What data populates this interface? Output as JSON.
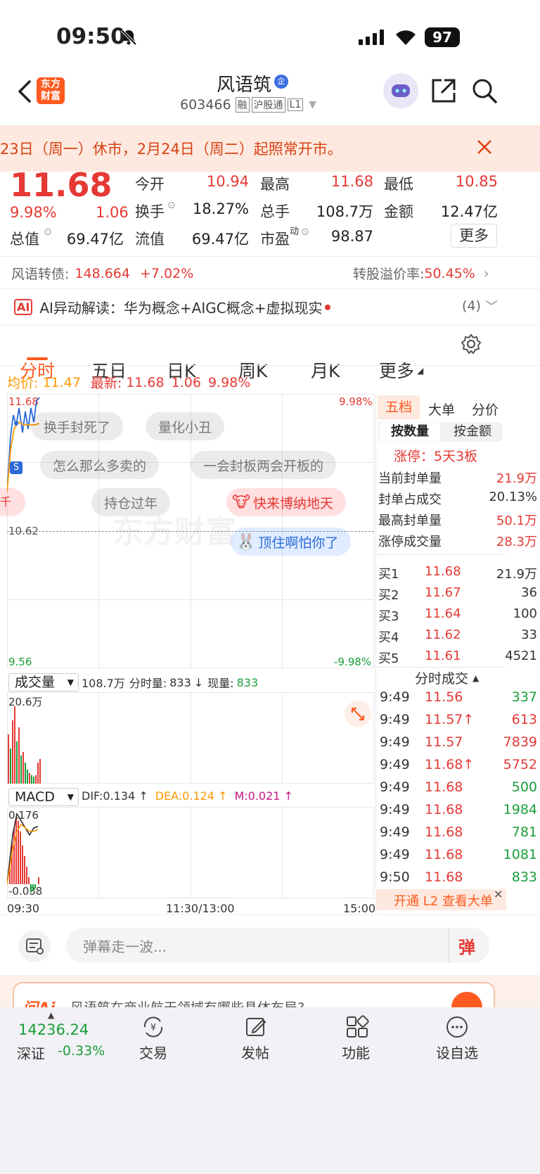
{
  "status_bar": {
    "time": "09:50",
    "battery": "97"
  },
  "header": {
    "logo_line1": "东方",
    "logo_line2": "财富",
    "stock_name": "风语筑",
    "badge_qi": "企",
    "stock_code": "603466",
    "tag_rong": "融",
    "tag_hgt": "沪股通",
    "tag_l1": "L1"
  },
  "banner": {
    "text": "23日（周一）休市，2月24日（周二）起照常开市。"
  },
  "quote": {
    "price": "11.68",
    "change_pct": "9.98%",
    "change": "1.06",
    "open_label": "今开",
    "open": "10.94",
    "high_label": "最高",
    "high": "11.68",
    "low_label": "最低",
    "low": "10.85",
    "turnover_label": "换手",
    "turnover": "18.27%",
    "volume_label": "总手",
    "volume": "108.7万",
    "amount_label": "金额",
    "amount": "12.47亿",
    "mcap_label": "总值",
    "mcap": "69.47亿",
    "float_label": "流值",
    "float_cap": "69.47亿",
    "pe_label": "市盈",
    "pe_sup": "动",
    "pe": "98.87",
    "more_button": "更多"
  },
  "bond": {
    "label": "风语转债:",
    "price": "148.664",
    "pct": "+7.02%",
    "premium_label": "转股溢价率:",
    "premium": "50.45%"
  },
  "ai": {
    "text": "AI异动解读：华为概念+AIGC概念+虚拟现实",
    "count": "(4)"
  },
  "tabs": [
    "分时",
    "五日",
    "日K",
    "周K",
    "月K",
    "更多"
  ],
  "summary": {
    "avg_label": "均价:",
    "avg": "11.47",
    "latest_label": "最新:",
    "latest": "11.68",
    "latest_chg": "1.06",
    "latest_pct": "9.98%"
  },
  "chart": {
    "top_left": "11.68",
    "top_right": "9.98%",
    "mid_left": "10.62",
    "bottom_left": "9.56",
    "bottom_right": "-9.98%",
    "s_marker": "S",
    "watermark": "东方财富"
  },
  "danmu": [
    "换手封死了",
    "量化小丑",
    "怎么那么多卖的",
    "一会封板两会开板的",
    "持仓过年",
    "快来博纳地天",
    "顶住啊怕你了"
  ],
  "volume_panel": {
    "label": "成交量",
    "total": "108.7万",
    "fen_label": "分时量:",
    "fen": "833",
    "now_label": "现量:",
    "now": "833",
    "max": "20.6万"
  },
  "macd_panel": {
    "label": "MACD",
    "dif": "DIF:0.134 ↑",
    "dea": "DEA:0.124 ↑",
    "m": "M:0.021 ↑",
    "top": "0.176",
    "bottom": "-0.038"
  },
  "time_axis": {
    "start": "09:30",
    "mid": "11:30/13:00",
    "end": "15:00"
  },
  "right_panel": {
    "tabs": [
      "五档",
      "大单",
      "分价"
    ],
    "subtabs": [
      "按数量",
      "按金额"
    ],
    "limit_info": "涨停：5天3板",
    "stats": [
      {
        "label": "当前封单量",
        "value": "21.9万"
      },
      {
        "label": "封单占成交",
        "value": "20.13%"
      },
      {
        "label": "最高封单量",
        "value": "50.1万"
      },
      {
        "label": "涨停成交量",
        "value": "28.3万"
      }
    ],
    "bids": [
      {
        "label": "买1",
        "price": "11.68",
        "vol": "21.9万"
      },
      {
        "label": "买2",
        "price": "11.67",
        "vol": "36"
      },
      {
        "label": "买3",
        "price": "11.64",
        "vol": "100"
      },
      {
        "label": "买4",
        "price": "11.62",
        "vol": "33"
      },
      {
        "label": "买5",
        "price": "11.61",
        "vol": "4521"
      }
    ],
    "trades_title": "分时成交",
    "trades": [
      {
        "time": "9:49",
        "price": "11.56",
        "vol": "337",
        "pc": "red",
        "vc": "green"
      },
      {
        "time": "9:49",
        "price": "11.57↑",
        "vol": "613",
        "pc": "red",
        "vc": "red"
      },
      {
        "time": "9:49",
        "price": "11.57",
        "vol": "7839",
        "pc": "red",
        "vc": "red"
      },
      {
        "time": "9:49",
        "price": "11.68↑",
        "vol": "5752",
        "pc": "red",
        "vc": "red"
      },
      {
        "time": "9:49",
        "price": "11.68",
        "vol": "500",
        "pc": "red",
        "vc": "green"
      },
      {
        "time": "9:49",
        "price": "11.68",
        "vol": "1984",
        "pc": "red",
        "vc": "green"
      },
      {
        "time": "9:49",
        "price": "11.68",
        "vol": "781",
        "pc": "red",
        "vc": "green"
      },
      {
        "time": "9:49",
        "price": "11.68",
        "vol": "1081",
        "pc": "red",
        "vc": "green"
      },
      {
        "time": "9:50",
        "price": "11.68",
        "vol": "833",
        "pc": "red",
        "vc": "green"
      }
    ],
    "l2_cta": "开通 L2 查看大单"
  },
  "comment_bar": {
    "placeholder": "弹幕走一波...",
    "dan_button": "弹"
  },
  "ai_ask": {
    "logo": "问Ai",
    "text": "风语筑在商业航天领域有哪些具体布局?"
  },
  "bottom_nav": {
    "index_value": "14236.24",
    "index_name": "深证",
    "index_pct": "-0.33%",
    "items": [
      "交易",
      "发帖",
      "功能",
      "设自选"
    ]
  },
  "colors": {
    "up": "#e53935",
    "down": "#1a9e3a",
    "accent": "#ff5a1f",
    "banner_bg": "#fde9df"
  }
}
